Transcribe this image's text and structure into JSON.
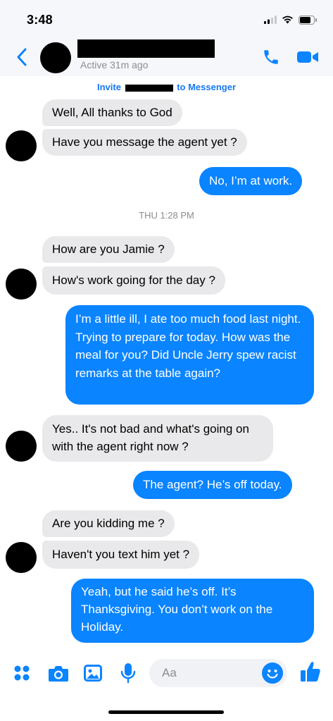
{
  "status_bar": {
    "time": "3:48"
  },
  "header": {
    "contact_name": "",
    "active_status": "Active 31m ago"
  },
  "invite": {
    "prefix": "Invite",
    "suffix": "to Messenger"
  },
  "timestamp": "THU 1:28 PM",
  "messages": [
    {
      "from": "them",
      "text": "Well, All thanks to God"
    },
    {
      "from": "them",
      "text": "Have you message the agent yet ?"
    },
    {
      "from": "me",
      "text": "No, I’m at work."
    },
    {
      "from": "them",
      "text": "How are you Jamie ?"
    },
    {
      "from": "them",
      "text": "How's work going for the day ?"
    },
    {
      "from": "me",
      "text": "I’m a little ill, I ate too much food last night. Trying to prepare for today. How was the meal for you? Did Uncle Jerry spew racist remarks at the table again?"
    },
    {
      "from": "them",
      "text": "Yes.. It's not bad and what's going on with the agent right now ?"
    },
    {
      "from": "me",
      "text": "The agent? He’s off today."
    },
    {
      "from": "them",
      "text": "Are you kidding me ?"
    },
    {
      "from": "them",
      "text": "Haven't you text him yet ?"
    },
    {
      "from": "me",
      "text": "Yeah, but he said he’s off. It’s Thanksgiving. You don’t work on the Holiday."
    }
  ],
  "composer": {
    "placeholder": "Aa",
    "icons": [
      "apps-icon",
      "camera-icon",
      "gallery-icon",
      "microphone-icon",
      "emoji-icon",
      "thumbs-up-icon"
    ]
  },
  "colors": {
    "accent": "#0a84ff",
    "link": "#1877f2",
    "incoming_bubble": "#e9e9eb",
    "secondary_text": "#8a8d91"
  }
}
